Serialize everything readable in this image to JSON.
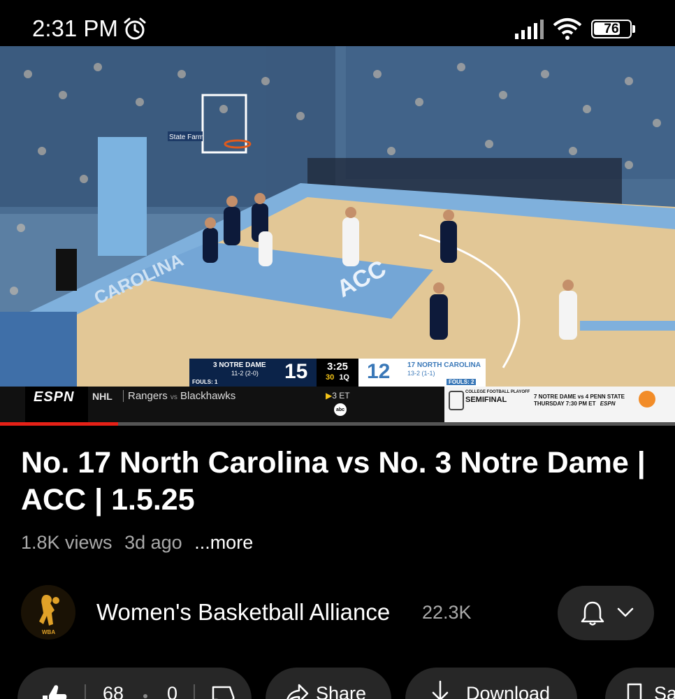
{
  "status_bar": {
    "time": "2:31 PM",
    "battery": "76",
    "battery_level": 0.76,
    "icons": [
      "alarm-icon",
      "signal-icon",
      "wifi-icon",
      "battery-icon"
    ]
  },
  "player": {
    "progress": 0.175,
    "progress_color": "#e62117",
    "scorebug": {
      "team1_name": "3 NOTRE DAME",
      "team1_record": "11-2 (2-0)",
      "team1_fouls": "FOULS: 1",
      "team1_score": "15",
      "clock": "3:25",
      "shot_clock": "30",
      "period": "1Q",
      "team2_score": "12",
      "team2_name": "17 NORTH CAROLINA",
      "team2_record": "13-2 (1-1)",
      "team2_fouls": "FOULS: 2"
    },
    "ticker": {
      "network": "ESPN",
      "league": "NHL",
      "game": "Rangers",
      "vs": "vs",
      "opponent": "Blackhawks",
      "status": "3 ET",
      "broadcaster": "abc",
      "promo_top": "COLLEGE FOOTBALL PLAYOFF",
      "promo_main": "SEMIFINAL",
      "promo_game": "7 NOTRE DAME vs 4 PENN STATE",
      "promo_time": "THURSDAY 7:30 PM ET",
      "promo_network": "ESPN"
    },
    "court_text": "CAROLINA",
    "court_logo": "ACC",
    "sponsor": "State Farm"
  },
  "video": {
    "title": "No. 17 North Carolina vs No. 3 Notre Dame | ACC | 1.5.25",
    "views": "1.8K views",
    "age": "3d ago",
    "more": "...more"
  },
  "channel": {
    "name": "Women's Basketball Alliance",
    "subscribers": "22.3K",
    "avatar_text": "WBA"
  },
  "actions": {
    "likes": "68",
    "dislikes": "0",
    "share": "Share",
    "download": "Download",
    "save": "Sa"
  }
}
